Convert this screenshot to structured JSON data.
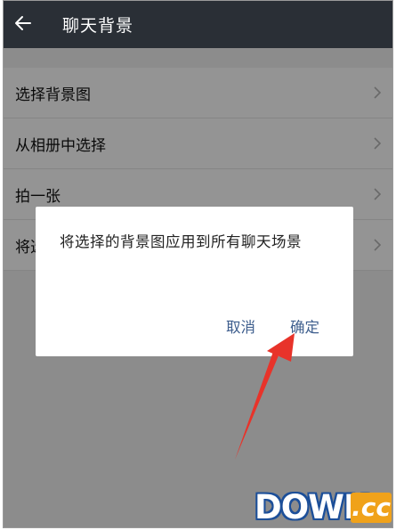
{
  "header": {
    "title": "聊天背景",
    "back_icon": "back-arrow-icon"
  },
  "list": {
    "items": [
      {
        "label": "选择背景图",
        "icon": "chevron-right-icon"
      },
      {
        "label": "从相册中选择",
        "icon": "chevron-right-icon"
      },
      {
        "label": "拍一张",
        "icon": "chevron-right-icon"
      },
      {
        "label": "将选",
        "icon": "chevron-right-icon"
      }
    ]
  },
  "dialog": {
    "message": "将选择的背景图应用到所有聊天场景",
    "cancel_label": "取消",
    "confirm_label": "确定"
  },
  "annotation": {
    "arrow_color": "#e8332a",
    "points_to": "confirm-button"
  },
  "watermark": {
    "text": "DOWN",
    "suffix": ".cc"
  },
  "colors": {
    "topbar": "#2a2f36",
    "dialog_button": "#3f5f8e",
    "watermark_blue": "#1c4f99",
    "watermark_orange": "#f0a21a"
  }
}
